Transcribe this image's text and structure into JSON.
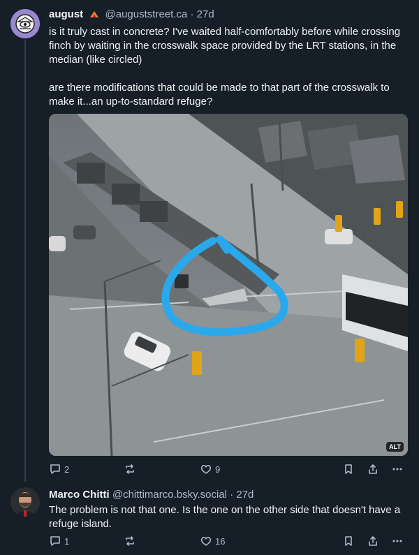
{
  "posts": [
    {
      "author_name": "august",
      "handle": "@auguststreet.ca",
      "separator": "·",
      "time": "27d",
      "text": "is it truly cast in concrete? I've waited half-comfortably before while crossing finch by waiting in the crosswalk space provided by the LRT stations, in the median (like circled)\n\nare there modifications that could be made to that part of the crosswalk to make it...an up-to-standard refuge?",
      "image_alt_badge": "ALT",
      "replies": "2",
      "reposts": "",
      "likes": "9"
    },
    {
      "author_name": "Marco Chitti",
      "handle": "@chittimarco.bsky.social",
      "separator": "·",
      "time": "27d",
      "text": "The problem is not that one. Is the one on the other side that doesn't have a refuge island.",
      "replies": "1",
      "reposts": "",
      "likes": "16"
    }
  ],
  "colors": {
    "background": "#161e27",
    "muted_text": "#aebbc9",
    "thread_line": "#2e4052",
    "circle_annotation": "#29a8ec"
  },
  "icons": [
    "reply-icon",
    "repost-icon",
    "like-icon",
    "bookmark-icon",
    "share-icon",
    "more-icon"
  ]
}
